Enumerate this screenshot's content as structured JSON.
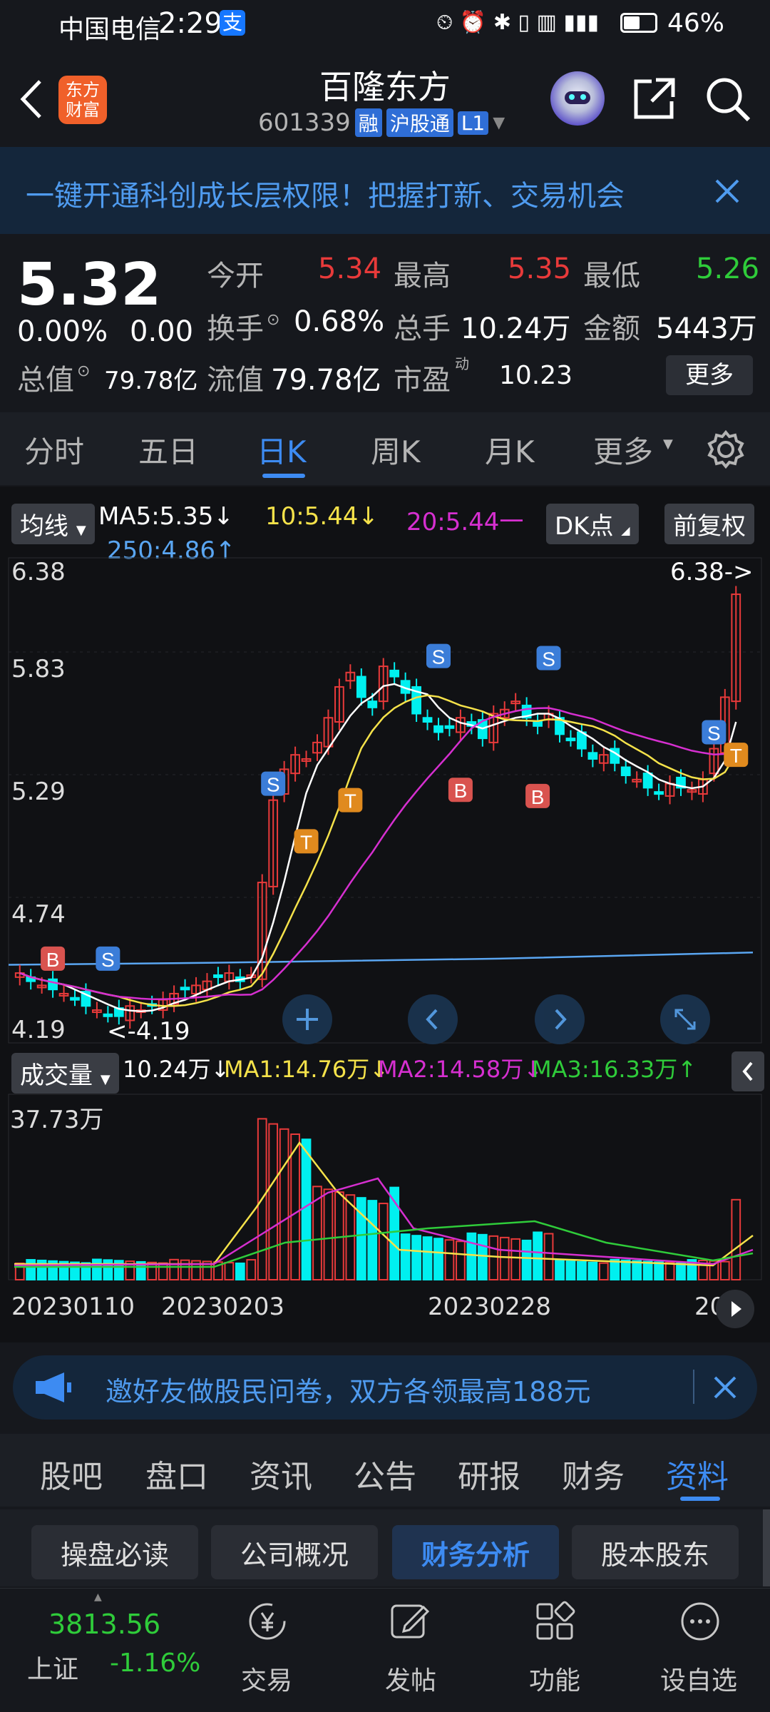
{
  "status": {
    "carrier": "中国电信",
    "time": "2:29",
    "battery": "46%"
  },
  "header": {
    "logo_text": "东方\n财富",
    "stock_name": "百隆东方",
    "code": "601339",
    "badge_rong": "融",
    "badge_hgt": "沪股通",
    "badge_l1": "L1"
  },
  "banner": {
    "text": "一键开通科创成长层权限！把握打新、交易机会"
  },
  "quote": {
    "price": "5.32",
    "change_pct": "0.00%",
    "change": "0.00",
    "open_label": "今开",
    "open": "5.34",
    "high_label": "最高",
    "high": "5.35",
    "low_label": "最低",
    "low": "5.26",
    "turnover_label": "换手",
    "turnover": "0.68%",
    "volume_label": "总手",
    "volume": "10.24万",
    "amount_label": "金额",
    "amount": "5443万",
    "mktcap_label": "总值",
    "mktcap": "79.78亿",
    "float_label": "流值",
    "float": "79.78亿",
    "pe_label": "市盈",
    "pe_sup": "动",
    "pe": "10.23",
    "more": "更多"
  },
  "tabs": [
    "分时",
    "五日",
    "日K",
    "周K",
    "月K",
    "更多"
  ],
  "tabs_active": 2,
  "ma": {
    "selector": "均线",
    "ma5": "MA5:5.35↓",
    "ma10": "10:5.44↓",
    "ma20": "20:5.44一",
    "ma250": "250:4.86↑",
    "dk": "DK点",
    "fq": "前复权"
  },
  "kline": {
    "y_labels": [
      "6.38",
      "5.83",
      "5.29",
      "4.74",
      "4.19"
    ],
    "max_note": "6.38->",
    "min_note": "<-4.19"
  },
  "vol": {
    "selector": "成交量",
    "v": "10.24万↓",
    "ma1": "MA1:14.76万↓",
    "ma2": "MA2:14.58万↓",
    "ma3": "MA3:16.33万↑",
    "ymax": "37.73万"
  },
  "dates": [
    "20230110",
    "20230203",
    "20230228",
    "20"
  ],
  "promo": {
    "text": "邀好友做股民问卷，双方各领最高188元"
  },
  "bottom_tabs": [
    "股吧",
    "盘口",
    "资讯",
    "公告",
    "研报",
    "财务",
    "资料"
  ],
  "bottom_active": 6,
  "sub_tabs": [
    "操盘必读",
    "公司概况",
    "财务分析",
    "股本股东"
  ],
  "sub_active": 2,
  "footer": {
    "index_value": "3813.56",
    "index_name": "上证",
    "index_change": "-1.16%",
    "items": [
      "交易",
      "发帖",
      "功能",
      "设自选"
    ]
  },
  "colors": {
    "up": "#e83a3a",
    "down": "#00f0f0",
    "ma5": "#ffffff",
    "ma10": "#f5e24a",
    "ma20": "#d62fd0",
    "ma250": "#5aa6f2",
    "active_blue": "#3d8bf2"
  }
}
